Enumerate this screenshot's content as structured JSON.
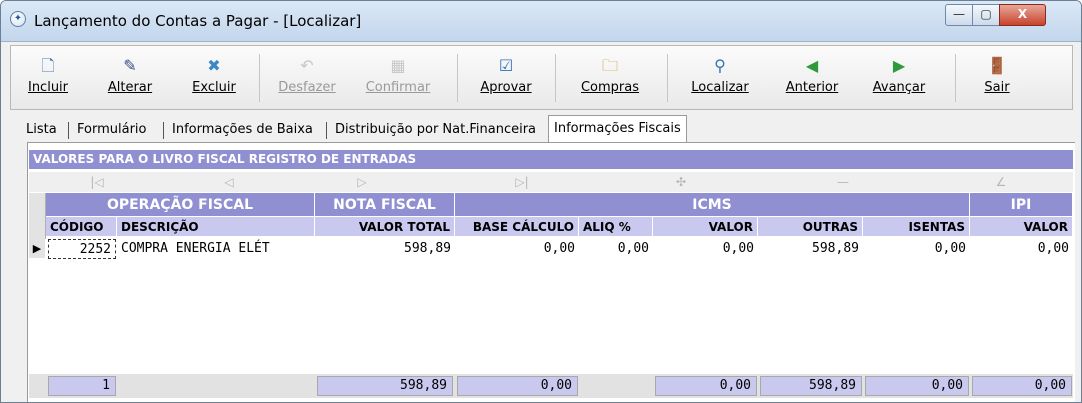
{
  "window": {
    "title": "Lançamento do Contas a Pagar - [Localizar]",
    "controls": {
      "minimize": "—",
      "maximize": "▢",
      "close": "X"
    }
  },
  "toolbar": [
    {
      "label": "Incluir",
      "icon": "new-document-icon",
      "glyph": "🗋",
      "enabled": true
    },
    {
      "label": "Alterar",
      "icon": "edit-icon",
      "glyph": "✎",
      "enabled": true
    },
    {
      "label": "Excluir",
      "icon": "delete-icon",
      "glyph": "✖",
      "enabled": true
    },
    {
      "label": "Desfazer",
      "icon": "undo-icon",
      "glyph": "↶",
      "enabled": false
    },
    {
      "label": "Confirmar",
      "icon": "confirm-icon",
      "glyph": "▦",
      "enabled": false
    },
    {
      "label": "Aprovar",
      "icon": "approve-icon",
      "glyph": "☑",
      "enabled": true
    },
    {
      "label": "Compras",
      "icon": "purchases-icon",
      "glyph": "🗀",
      "enabled": true
    },
    {
      "label": "Localizar",
      "icon": "search-icon",
      "glyph": "⚲",
      "enabled": true
    },
    {
      "label": "Anterior",
      "icon": "arrow-left-icon",
      "glyph": "◀",
      "enabled": true
    },
    {
      "label": "Avançar",
      "icon": "arrow-right-icon",
      "glyph": "▶",
      "enabled": true
    },
    {
      "label": "Sair",
      "icon": "exit-door-icon",
      "glyph": "🚪",
      "enabled": true
    }
  ],
  "tabs": [
    {
      "label": "Lista",
      "active": false
    },
    {
      "label": "Formulário",
      "active": false
    },
    {
      "label": "Informações de Baixa",
      "active": false
    },
    {
      "label": "Distribuição por Nat.Financeira",
      "active": false
    },
    {
      "label": "Informações Fiscais",
      "active": true
    }
  ],
  "section_title": "VALORES PARA O LIVRO FISCAL REGISTRO DE ENTRADAS",
  "navigator": [
    {
      "name": "first-record-icon",
      "glyph": "|◁"
    },
    {
      "name": "prior-record-icon",
      "glyph": "◁"
    },
    {
      "name": "next-record-icon",
      "glyph": "▷"
    },
    {
      "name": "last-record-icon",
      "glyph": "▷|"
    },
    {
      "name": "insert-record-icon",
      "glyph": "✣"
    },
    {
      "name": "delete-record-icon",
      "glyph": "—"
    },
    {
      "name": "edit-record-icon",
      "glyph": "∠"
    }
  ],
  "grid": {
    "group_headers": [
      "OPERAÇÃO FISCAL",
      "NOTA FISCAL",
      "ICMS",
      "IPI"
    ],
    "columns": [
      "CÓDIGO",
      "DESCRIÇÃO",
      "VALOR TOTAL",
      "BASE CÁLCULO",
      "ALIQ %",
      "VALOR",
      "OUTRAS",
      "ISENTAS",
      "VALOR"
    ],
    "rows": [
      [
        "2252",
        "COMPRA ENERGIA ELÉT",
        "598,89",
        "0,00",
        "0,00",
        "0,00",
        "598,89",
        "0,00",
        "0,00"
      ]
    ],
    "totals": {
      "count": "1",
      "valor_total": "598,89",
      "base_calculo": "0,00",
      "icms_valor": "0,00",
      "outras": "598,89",
      "isentas": "0,00",
      "ipi_valor": "0,00"
    }
  }
}
